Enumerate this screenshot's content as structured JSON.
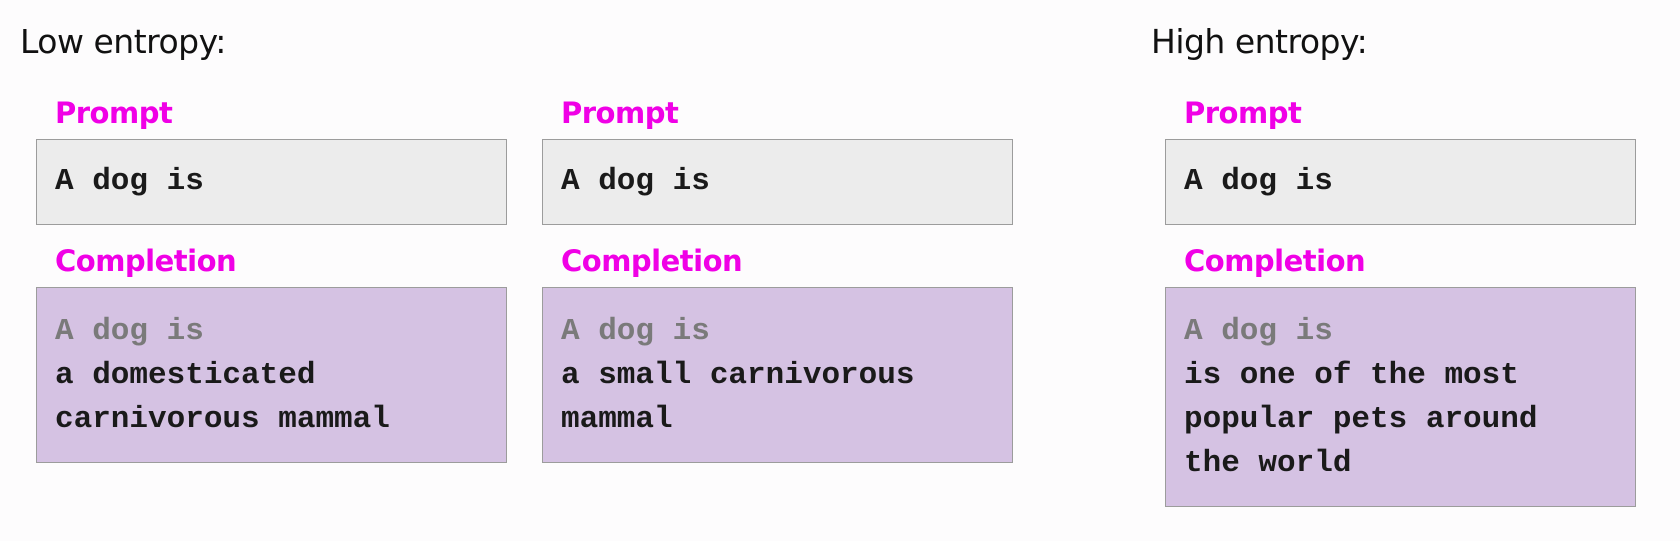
{
  "low_entropy": {
    "heading": "Low entropy:",
    "examples": [
      {
        "prompt_label": "Prompt",
        "prompt_text": "A dog is",
        "completion_label": "Completion",
        "completion_echo": "A dog is",
        "completion_lines": [
          "a domesticated",
          "carnivorous mammal"
        ]
      },
      {
        "prompt_label": "Prompt",
        "prompt_text": "A dog is",
        "completion_label": "Completion",
        "completion_echo": "A dog is",
        "completion_lines": [
          "a small carnivorous",
          "mammal"
        ]
      }
    ]
  },
  "high_entropy": {
    "heading": "High entropy:",
    "examples": [
      {
        "prompt_label": "Prompt",
        "prompt_text": "A dog is",
        "completion_label": "Completion",
        "completion_echo": "A dog is",
        "completion_lines": [
          "is one of the most",
          "popular pets around",
          "the world"
        ]
      }
    ]
  },
  "colors": {
    "label": "#f000e6",
    "prompt_bg": "#ececec",
    "completion_bg": "#d5c2e3",
    "echo_text": "#7a7a7a"
  }
}
